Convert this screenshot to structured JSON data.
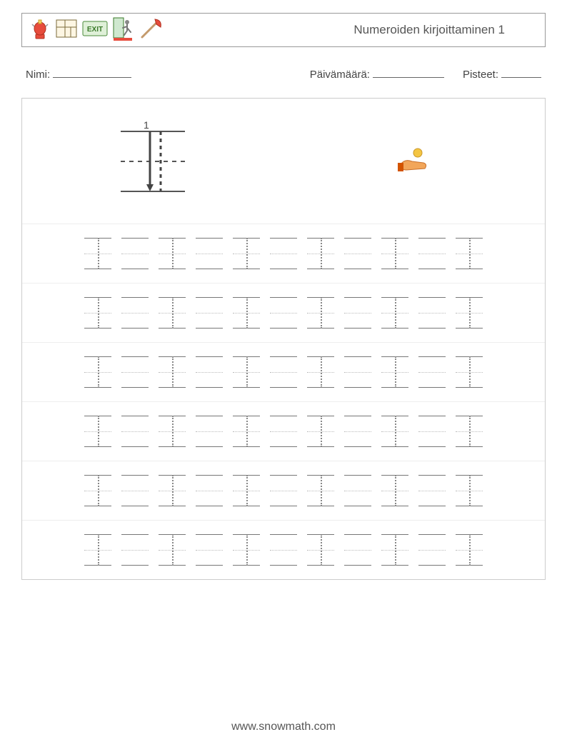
{
  "header": {
    "title": "Numeroiden kirjoittaminen 1",
    "icons": [
      "alarm-icon",
      "floorplan-icon",
      "exit-sign-icon",
      "emergency-exit-icon",
      "fire-axe-icon"
    ]
  },
  "fields": {
    "name_label": "Nimi:",
    "date_label": "Päivämäärä:",
    "score_label": "Pisteet:"
  },
  "demo": {
    "numeral_label": "1",
    "hand_icon": "coin-hand-icon"
  },
  "practice": {
    "rows": 6,
    "cells_per_row": 11,
    "trace_pattern": [
      true,
      false,
      true,
      false,
      true,
      false,
      true,
      false,
      true,
      false,
      true
    ]
  },
  "footer": {
    "text": "www.snowmath.com"
  }
}
